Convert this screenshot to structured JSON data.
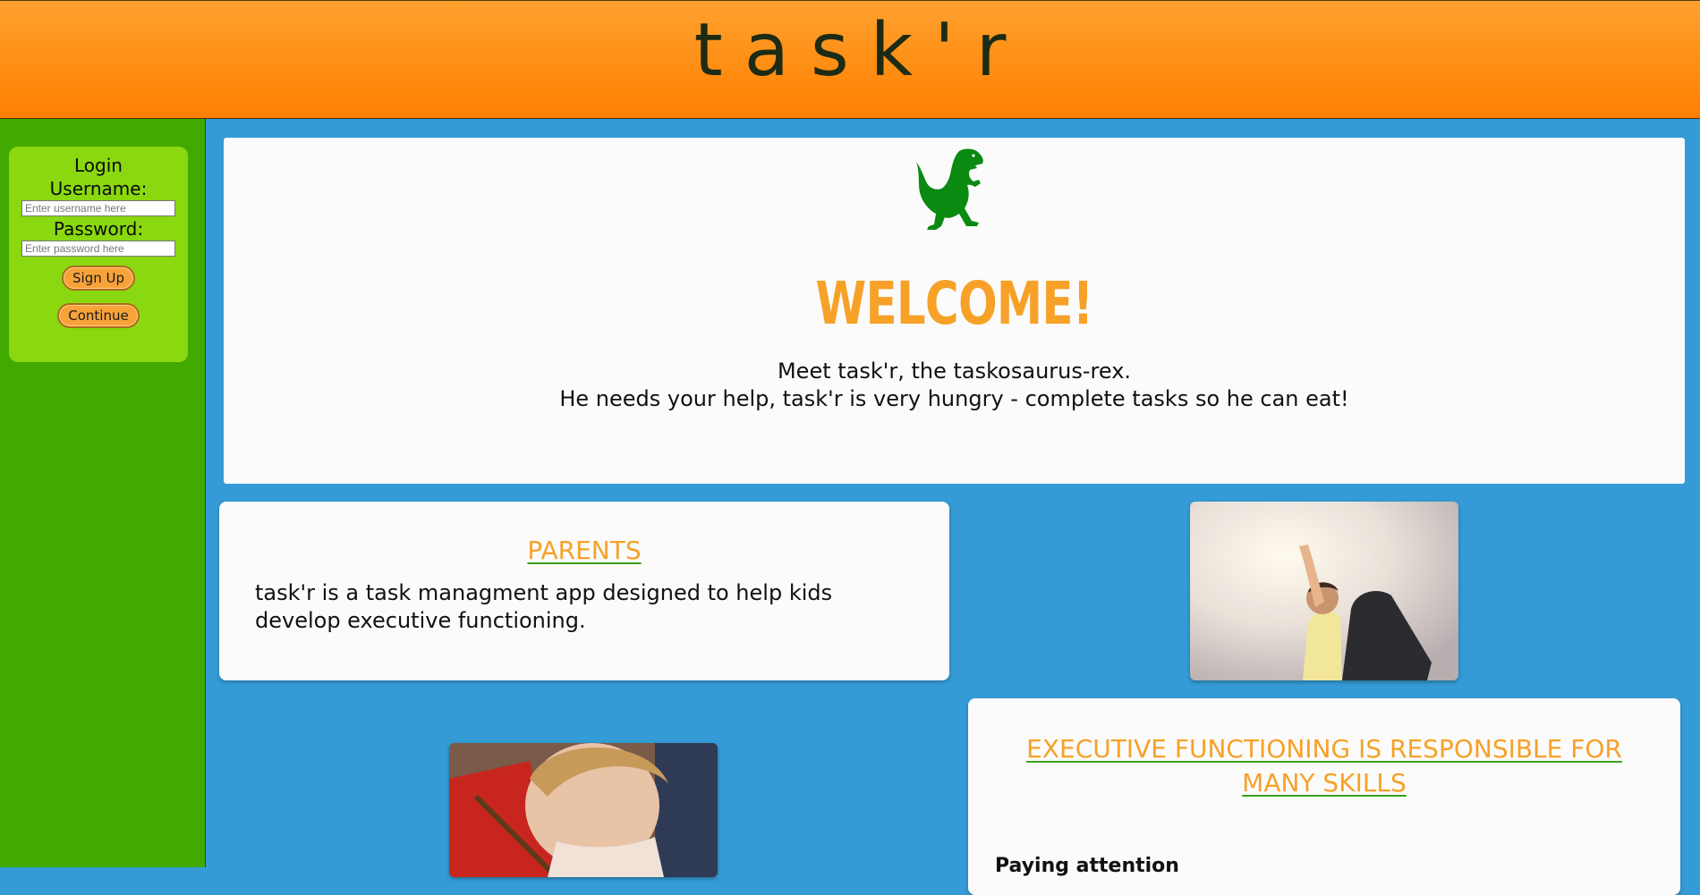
{
  "header": {
    "title": "task'r"
  },
  "login": {
    "heading": "Login",
    "username_label": "Username:",
    "username_placeholder": "Enter username here",
    "password_label": "Password:",
    "password_placeholder": "Enter password here",
    "signup_label": "Sign Up",
    "continue_label": "Continue"
  },
  "welcome": {
    "heading": "WELCOME!",
    "line1": "Meet task'r, the taskosaurus-rex.",
    "line2": "He needs your help, task'r is very hungry - complete tasks so he can eat!"
  },
  "parents": {
    "heading": "PARENTS",
    "text": "task'r is a task managment app designed to help kids develop executive functioning."
  },
  "executive": {
    "heading": "EXECUTIVE FUNCTIONING IS RESPONSIBLE FOR MANY SKILLS",
    "first_item": "Paying attention"
  },
  "colors": {
    "header": "#ff8c12",
    "sidebar": "#42a900",
    "login_box": "#8ad80f",
    "page_bg": "#349bd6",
    "accent_orange": "#f7a128",
    "dino_green": "#0b8a12"
  },
  "icons": {
    "mascot": "dinosaur-mascot-icon"
  }
}
